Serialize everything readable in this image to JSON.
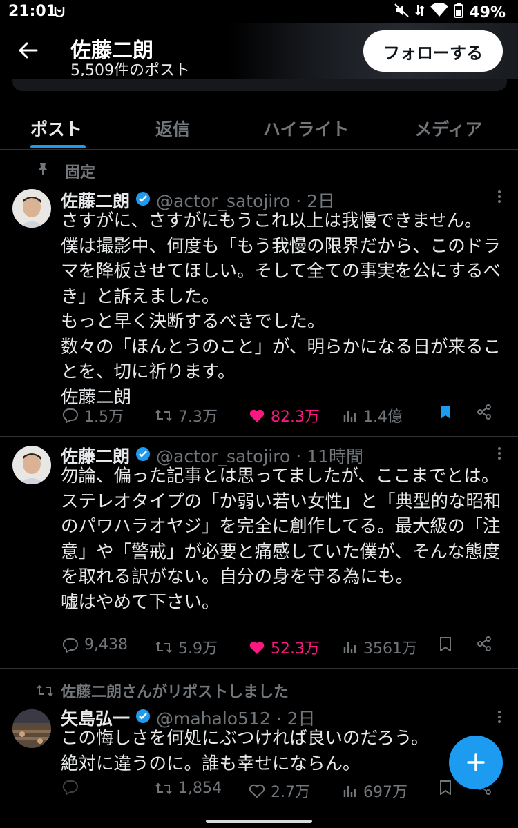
{
  "status": {
    "time": "21:01",
    "battery": "49%"
  },
  "header": {
    "name": "佐藤二朗",
    "post_count": "5,509件のポスト",
    "follow_label": "フォローする"
  },
  "tabs": [
    {
      "label": "ポスト"
    },
    {
      "label": "返信"
    },
    {
      "label": "ハイライト"
    },
    {
      "label": "メディア"
    }
  ],
  "posts": [
    {
      "pinned_label": "固定",
      "name": "佐藤二朗",
      "handle_time": "@actor_satojiro · 2日",
      "text": "さすがに、さすがにもうこれ以上は我慢できません。\n僕は撮影中、何度も「もう我慢の限界だから、このドラマを降板させてほしい。そして全ての事実を公にするべき」と訴えました。\nもっと早く決断するべきでした。\n数々の「ほんとうのこと」が、明らかになる日が来ることを、切に祈ります。\n佐藤二朗",
      "replies": "1.5万",
      "reposts": "7.3万",
      "likes": "82.3万",
      "views": "1.4億"
    },
    {
      "name": "佐藤二朗",
      "handle_time": "@actor_satojiro · 11時間",
      "text": "勿論、偏った記事とは思ってましたが、ここまでとは。ステレオタイプの「か弱い若い女性」と「典型的な昭和のパワハラオヤジ」を完全に創作してる。最大級の「注意」や「警戒」が必要と痛感していた僕が、そんな態度を取れる訳がない。自分の身を守る為にも。\n嘘はやめて下さい。",
      "replies": "9,438",
      "reposts": "5.9万",
      "likes": "52.3万",
      "views": "3561万"
    },
    {
      "repost_label": "佐藤二朗さんがリポストしました",
      "name": "矢島弘一",
      "handle_time": "@mahalo512 · 2日",
      "text": "この悔しさを何処にぶつければ良いのだろう。\n絶対に違うのに。誰も幸せにならん。",
      "replies": "",
      "reposts": "1,854",
      "likes": "2.7万",
      "views": "697万"
    }
  ],
  "colors": {
    "accent": "#1d9bf0",
    "like": "#f91880",
    "muted": "#71767b",
    "text": "#e7e9ea",
    "bg": "#000000"
  }
}
